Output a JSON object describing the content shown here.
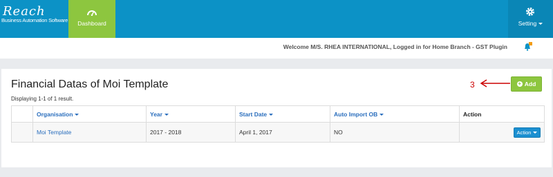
{
  "header": {
    "brand_logo": "Reach",
    "brand_tagline": "Business Automation Software",
    "dashboard_label": "Dashboard",
    "setting_label": "Setting",
    "accent_color": "#0c92c6",
    "dashboard_color": "#8dc63f"
  },
  "welcome": {
    "text": "Welcome M/S. RHEA INTERNATIONAL, Logged in for Home Branch - GST Plugin"
  },
  "page": {
    "title": "Financial Datas of Moi Template",
    "summary": "Displaying 1-1 of 1 result.",
    "annotation": "3",
    "add_label": "Add"
  },
  "table": {
    "columns": [
      "Organisation",
      "Year",
      "Start Date",
      "Auto Import OB",
      "Action"
    ],
    "rows": [
      {
        "organisation": "Moi Template",
        "year": "2017 - 2018",
        "start_date": "April 1, 2017",
        "auto_import_ob": "NO",
        "action_label": "Action"
      }
    ]
  }
}
